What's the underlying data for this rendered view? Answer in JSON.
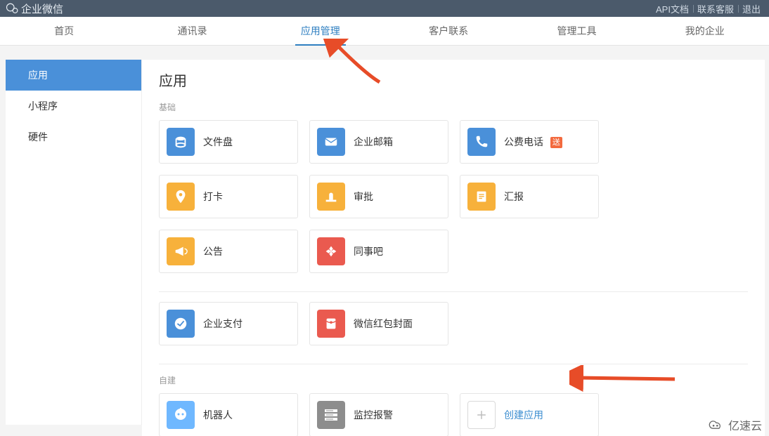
{
  "brand": "企业微信",
  "toplinks": {
    "api_docs": "API文档",
    "contact": "联系客服",
    "logout": "退出"
  },
  "nav": {
    "home": "首页",
    "contacts": "通讯录",
    "app_mgmt": "应用管理",
    "customer": "客户联系",
    "tools": "管理工具",
    "my_org": "我的企业"
  },
  "sidebar": {
    "apps": "应用",
    "miniprograms": "小程序",
    "hardware": "硬件"
  },
  "page_title": "应用",
  "sections": {
    "basic_label": "基础",
    "custom_label": "自建"
  },
  "basic_apps": [
    {
      "key": "drive",
      "name": "文件盘"
    },
    {
      "key": "mail",
      "name": "企业邮箱"
    },
    {
      "key": "phone",
      "name": "公费电话",
      "badge": "送"
    },
    {
      "key": "checkin",
      "name": "打卡"
    },
    {
      "key": "approval",
      "name": "审批"
    },
    {
      "key": "report",
      "name": "汇报"
    },
    {
      "key": "announce",
      "name": "公告"
    },
    {
      "key": "colleague",
      "name": "同事吧"
    }
  ],
  "extra_apps": [
    {
      "key": "pay",
      "name": "企业支付"
    },
    {
      "key": "redpacket",
      "name": "微信红包封面"
    }
  ],
  "custom_apps": [
    {
      "key": "robot",
      "name": "机器人"
    },
    {
      "key": "monitor",
      "name": "监控报警"
    },
    {
      "key": "create",
      "name": "创建应用",
      "create": true
    }
  ],
  "watermark": "亿速云",
  "colors": {
    "blue": "#4a90d9",
    "blue2": "#3b8dd0",
    "orange": "#f5a623",
    "orange2": "#f7b13b",
    "red": "#ea5a4f",
    "grey": "#8d8d8d"
  }
}
